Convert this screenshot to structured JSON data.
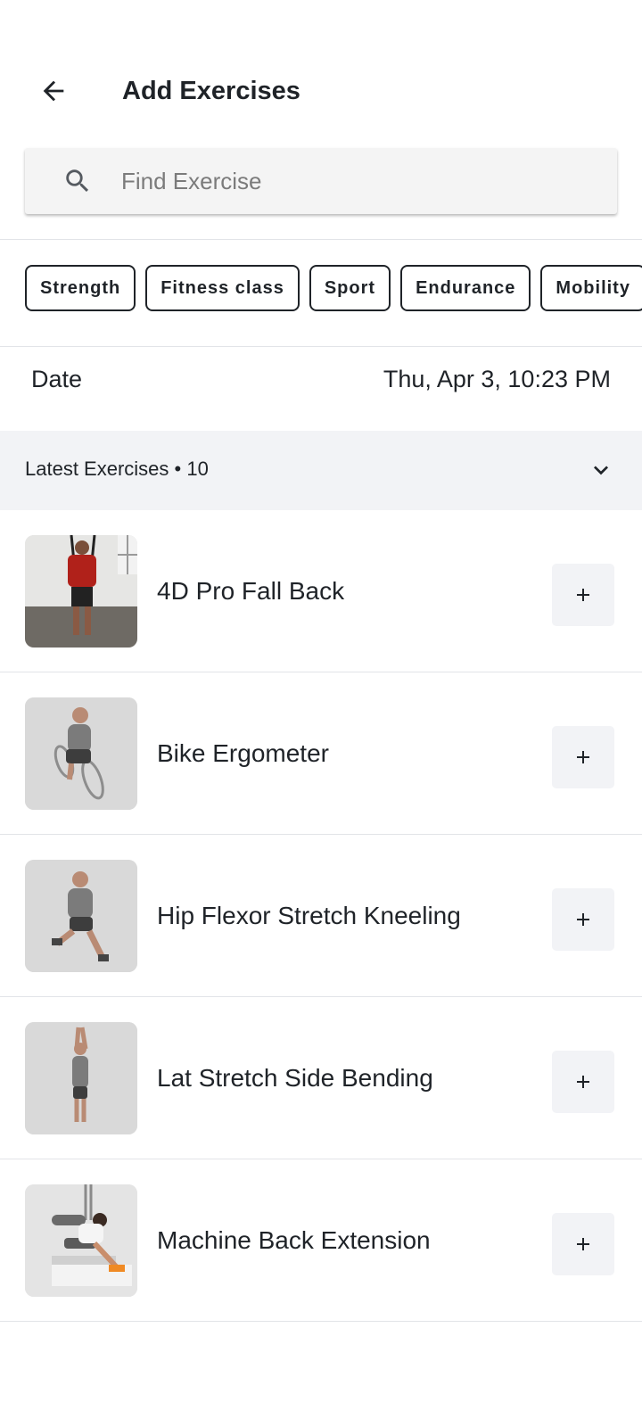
{
  "header": {
    "title": "Add Exercises",
    "back_icon": "arrow-left-icon"
  },
  "search": {
    "placeholder": "Find Exercise",
    "value": "",
    "icon": "search-icon"
  },
  "filters": [
    {
      "label": "Strength"
    },
    {
      "label": "Fitness class"
    },
    {
      "label": "Sport"
    },
    {
      "label": "Endurance"
    },
    {
      "label": "Mobility"
    }
  ],
  "date": {
    "label": "Date",
    "value": "Thu, Apr 3, 10:23 PM"
  },
  "section": {
    "title": "Latest Exercises • 10",
    "chevron_icon": "chevron-down-icon"
  },
  "exercises": [
    {
      "name": "4D Pro Fall Back",
      "add_label": "+"
    },
    {
      "name": "Bike Ergometer",
      "add_label": "+"
    },
    {
      "name": "Hip Flexor Stretch Kneeling",
      "add_label": "+"
    },
    {
      "name": "Lat Stretch Side Bending",
      "add_label": "+"
    },
    {
      "name": "Machine Back Extension",
      "add_label": "+"
    }
  ],
  "colors": {
    "text": "#1f2328",
    "section_bg": "#f2f3f6",
    "search_bg": "#f4f4f4",
    "divider": "#e2e4e8"
  }
}
